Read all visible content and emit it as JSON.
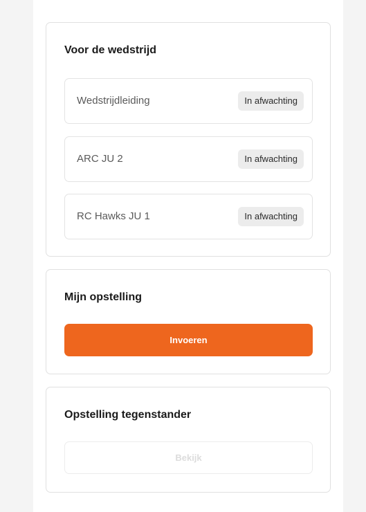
{
  "pre_match": {
    "title": "Voor de wedstrijd",
    "items": [
      {
        "label": "Wedstrijdleiding",
        "status": "In afwachting"
      },
      {
        "label": "ARC JU 2",
        "status": "In afwachting"
      },
      {
        "label": "RC Hawks JU 1",
        "status": "In afwachting"
      }
    ]
  },
  "my_lineup": {
    "title": "Mijn opstelling",
    "button_label": "Invoeren",
    "button_color": "#ee661e"
  },
  "opponent_lineup": {
    "title": "Opstelling tegenstander",
    "button_label": "Bekijk"
  }
}
